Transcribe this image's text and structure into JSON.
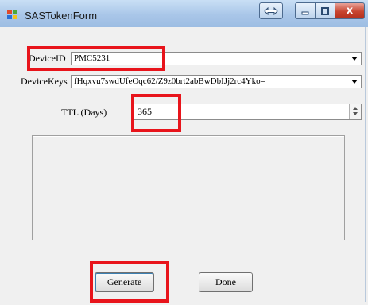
{
  "window": {
    "title": "SASTokenForm",
    "close_glyph": "x",
    "icons": [
      "app-icon",
      "resize-icon",
      "minimize-icon",
      "maximize-icon",
      "close-icon"
    ]
  },
  "form": {
    "device_id_label": "DeviceID",
    "device_id_value": "PMC5231",
    "device_keys_label": "DeviceKeys",
    "device_keys_value": "fHqxvu7swdUfeOqc62/Z9z0brt2abBwDbIJj2rc4Yko=",
    "ttl_label": "TTL (Days)",
    "ttl_value": "365"
  },
  "buttons": {
    "generate": "Generate",
    "done": "Done"
  },
  "highlights": {
    "color": "#e8141b"
  }
}
